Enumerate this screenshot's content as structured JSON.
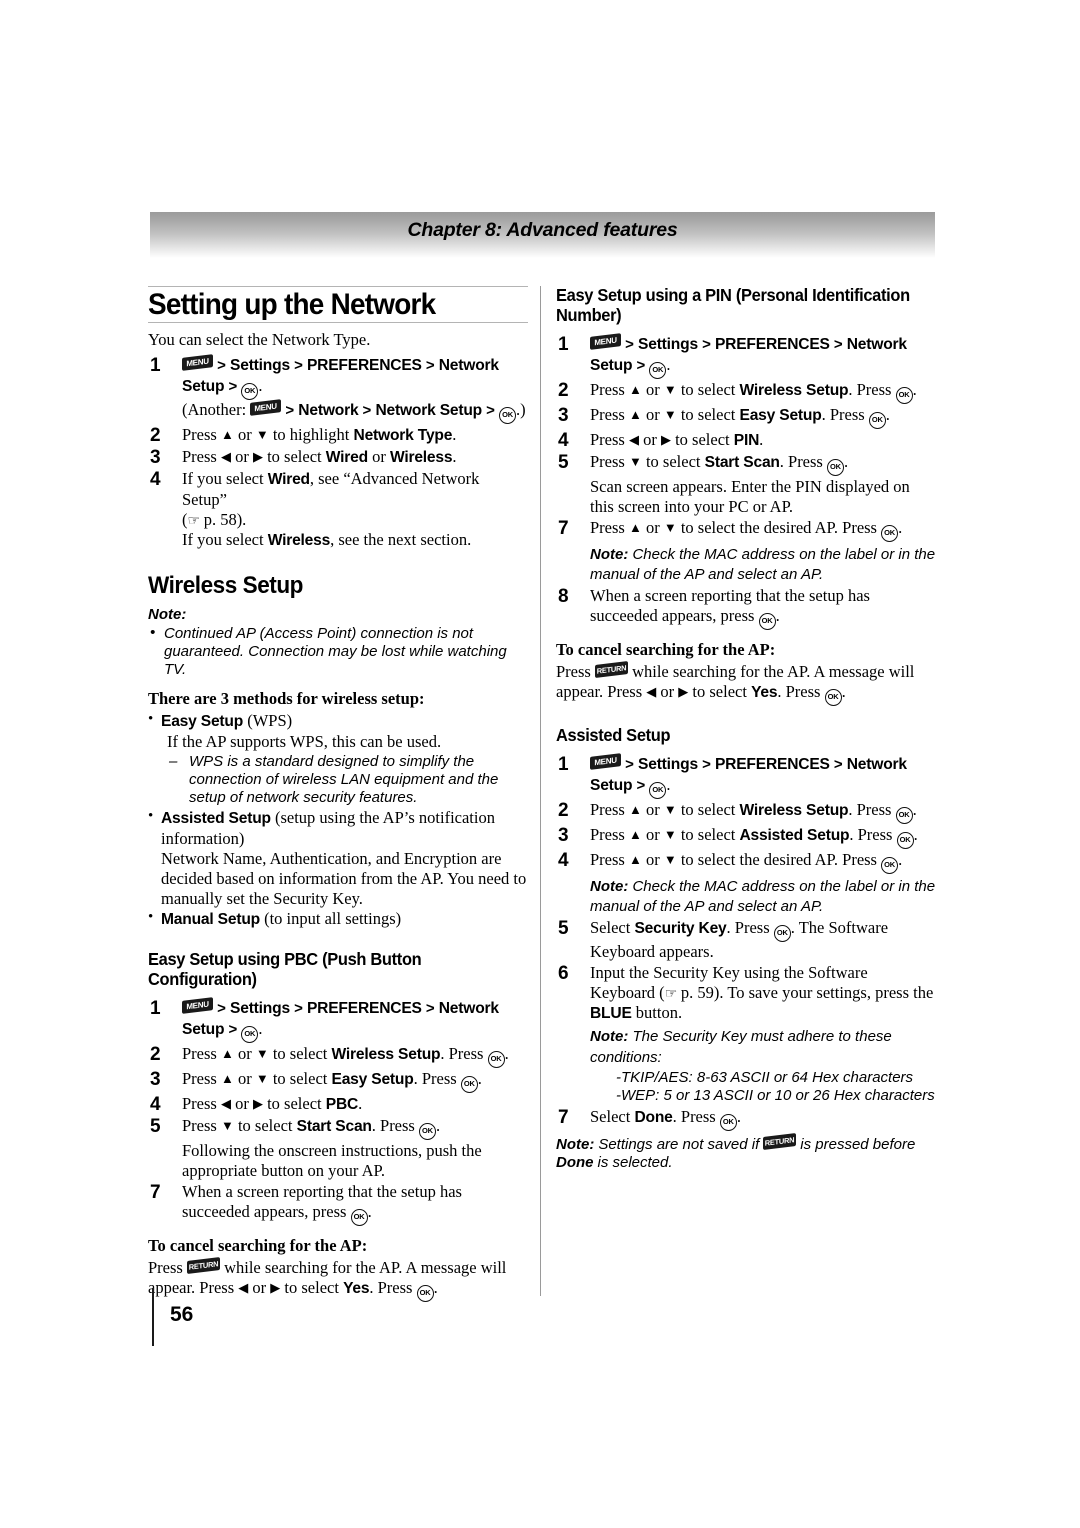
{
  "header": {
    "chapter": "Chapter 8: Advanced features"
  },
  "footer": {
    "page_number": "56"
  },
  "icons": {
    "menu": "MENU",
    "ok": "OK",
    "return": "RETURN",
    "hand": "☞",
    "up": "▲",
    "down": "▼",
    "left": "◀",
    "right": "▶",
    "gt": ">"
  },
  "left_column": {
    "title": "Setting up the Network",
    "intro": "You can select the Network Type.",
    "network_type_steps": {
      "s1_a": "Settings",
      "s1_b": "PREFERENCES",
      "s1_c": "Network Setup",
      "s1_another_lead": "(Another:",
      "s1_another_a": "Network",
      "s1_another_b": "Network Setup",
      "s2_lead": "Press",
      "s2_or": "or",
      "s2_mid": "to highlight",
      "s2_target": "Network Type",
      "s3_lead": "Press",
      "s3_or": "or",
      "s3_mid": "to select",
      "s3_opt1": "Wired",
      "s3_conj": "or",
      "s3_opt2": "Wireless",
      "s4_lead": "If you select",
      "s4_bold": "Wired",
      "s4_rest": ", see “Advanced Network Setup”",
      "s4_ref": "p. 58).",
      "s4_line2_lead": "If you select",
      "s4_line2_bold": "Wireless",
      "s4_line2_rest": ", see the next section."
    },
    "wireless_title": "Wireless Setup",
    "note_label": "Note:",
    "note_bullet": "Continued AP (Access Point) connection is not guaranteed. Connection may be lost while watching TV.",
    "methods_head": "There are 3 methods for wireless setup:",
    "method1_name": "Easy Setup",
    "method1_paren": "(WPS)",
    "method1_desc": "If the AP supports WPS, this can be used.",
    "method1_dash": "WPS is a standard designed to simplify the connection of wireless LAN equipment and the setup of network security features.",
    "method2_name": "Assisted Setup",
    "method2_paren": "(setup using the AP’s notification information)",
    "method2_desc": "Network Name, Authentication, and Encryption are decided based on information from the AP. You need to manually set the Security Key.",
    "method3_name": "Manual Setup",
    "method3_paren": "(to input all settings)",
    "pbc_title": "Easy Setup using PBC (Push Button Configuration)",
    "pbc_steps": {
      "s1_a": "Settings",
      "s1_b": "PREFERENCES",
      "s1_c": "Network Setup",
      "s2_lead": "Press",
      "s2_or": "or",
      "s2_mid": "to select",
      "s2_target": "Wireless Setup",
      "s2_tail": "Press",
      "s3_lead": "Press",
      "s3_or": "or",
      "s3_mid": "to select",
      "s3_target": "Easy Setup",
      "s3_tail": "Press",
      "s4_lead": "Press",
      "s4_or": "or",
      "s4_mid": "to select",
      "s4_target": "PBC",
      "s5_lead": "Press",
      "s5_mid": "to select",
      "s5_target": "Start Scan",
      "s5_tail": "Press",
      "s6": "Following the onscreen instructions, push the appropriate button on your AP.",
      "s7_lead": "When a screen reporting that the setup has succeeded appears, press"
    },
    "cancel_head": "To cancel searching for the AP:",
    "cancel_lead": "Press",
    "cancel_mid": "while searching for the AP. A message will appear. Press",
    "cancel_or": "or",
    "cancel_sel": "to select",
    "cancel_yes": "Yes",
    "cancel_tail": "Press"
  },
  "right_column": {
    "pin_title": "Easy Setup using a PIN (Personal Identification Number)",
    "pin_steps": {
      "s1_a": "Settings",
      "s1_b": "PREFERENCES",
      "s1_c": "Network Setup",
      "s2_lead": "Press",
      "s2_or": "or",
      "s2_mid": "to select",
      "s2_target": "Wireless Setup",
      "s2_tail": "Press",
      "s3_lead": "Press",
      "s3_or": "or",
      "s3_mid": "to select",
      "s3_target": "Easy Setup",
      "s3_tail": "Press",
      "s4_lead": "Press",
      "s4_or": "or",
      "s4_mid": "to select",
      "s4_target": "PIN",
      "s5_lead": "Press",
      "s5_mid": "to select",
      "s5_target": "Start Scan",
      "s5_tail": "Press",
      "s6": "Scan screen appears. Enter the PIN displayed on this screen into your PC or AP.",
      "s7_lead": "Press",
      "s7_or": "or",
      "s7_mid": "to select the desired AP. Press",
      "s7_note_label": "Note:",
      "s7_note": "Check the MAC address on the label or in the manual of the AP and select an AP.",
      "s8_lead": "When a screen reporting that the setup has succeeded appears, press"
    },
    "cancel_head": "To cancel searching for the AP:",
    "cancel_lead": "Press",
    "cancel_mid": "while searching for the AP. A message will appear. Press",
    "cancel_or": "or",
    "cancel_sel": "to select",
    "cancel_yes": "Yes",
    "cancel_tail": "Press",
    "assisted_title": "Assisted Setup",
    "assisted_steps": {
      "s1_a": "Settings",
      "s1_b": "PREFERENCES",
      "s1_c": "Network Setup",
      "s2_lead": "Press",
      "s2_or": "or",
      "s2_mid": "to select",
      "s2_target": "Wireless Setup",
      "s2_tail": "Press",
      "s3_lead": "Press",
      "s3_or": "or",
      "s3_mid": "to select",
      "s3_target": "Assisted Setup",
      "s3_tail": "Press",
      "s4_lead": "Press",
      "s4_or": "or",
      "s4_mid": "to select the desired AP. Press",
      "s4_note_label": "Note:",
      "s4_note": "Check the MAC address on the label or in the manual of the AP and select an AP.",
      "s5_lead": "Select",
      "s5_target": "Security Key",
      "s5_mid": "Press",
      "s5_tail": "The Software Keyboard appears.",
      "s6_lead": "Input the Security Key using the Software Keyboard (",
      "s6_ref": "p. 59). To save your settings, press the",
      "s6_blue": "BLUE",
      "s6_tail": "button.",
      "s6_note_label": "Note:",
      "s6_note": "The Security Key must adhere to these conditions:",
      "cond1": "-TKIP/AES: 8-63 ASCII or 64 Hex characters",
      "cond2": "-WEP: 5 or 13 ASCII or 10 or 26 Hex characters",
      "s7_lead": "Select",
      "s7_target": "Done",
      "s7_mid": "Press",
      "final_note_label": "Note:",
      "final_note_a": "Settings are not saved if",
      "final_note_b": "is pressed before",
      "final_note_bold": "Done",
      "final_note_c": "is selected."
    }
  }
}
